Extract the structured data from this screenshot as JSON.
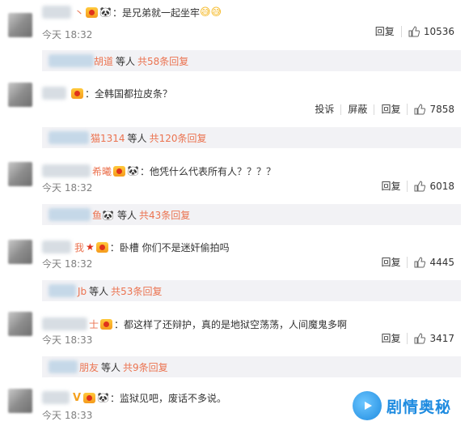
{
  "comments": [
    {
      "name_tail": "丶",
      "text": "是兄弟就一起坐牢",
      "emoji": "😅😅",
      "time": "今天 18:32",
      "actions": [
        "回复"
      ],
      "likes": "10536",
      "replies": {
        "name_tail": "胡道",
        "others": "等人",
        "count": "共58条回复"
      }
    },
    {
      "name_tail": "",
      "text": "全韩国都拉皮条？",
      "emoji": "",
      "time": "",
      "actions": [
        "投诉",
        "屏蔽",
        "回复"
      ],
      "likes": "7858",
      "replies": {
        "name_tail": "猫1314",
        "others": "等人",
        "count": "共120条回复"
      }
    },
    {
      "name_tail": "希曦",
      "text": "他凭什么代表所有人？？？？",
      "emoji": "",
      "time": "今天 18:32",
      "actions": [
        "回复"
      ],
      "likes": "6018",
      "replies": {
        "name_tail": "鱼",
        "others": "等人",
        "count": "共43条回复"
      }
    },
    {
      "name_tail": "我",
      "text": "卧槽 你们不是迷奸偷拍吗",
      "emoji": "",
      "time": "今天 18:32",
      "actions": [
        "回复"
      ],
      "likes": "4445",
      "replies": {
        "name_tail": "Jb",
        "others": "等人",
        "count": "共53条回复"
      }
    },
    {
      "name_tail": "士",
      "text": "都这样了还辩护，真的是地狱空荡荡，人间魔鬼多啊",
      "emoji": "",
      "time": "今天 18:33",
      "actions": [
        "回复"
      ],
      "likes": "3417",
      "replies": {
        "name_tail": "朋友",
        "others": "等人",
        "count": "共9条回复"
      }
    },
    {
      "name_tail": "",
      "text": "监狱见吧，废话不多说。",
      "emoji": "",
      "time": "今天 18:33",
      "actions": [],
      "likes": "",
      "replies": null
    }
  ],
  "watermark": {
    "text": "剧情奥秘"
  },
  "icons": {
    "badge": "vip-badge-icon",
    "panda": "panda-emoji-icon",
    "like": "thumb-up-icon",
    "logo": "play-logo-icon"
  },
  "colors": {
    "link": "#eb7350",
    "reply_bg": "#f2f2f5",
    "time": "#808080",
    "brand": "#1e8be0"
  }
}
